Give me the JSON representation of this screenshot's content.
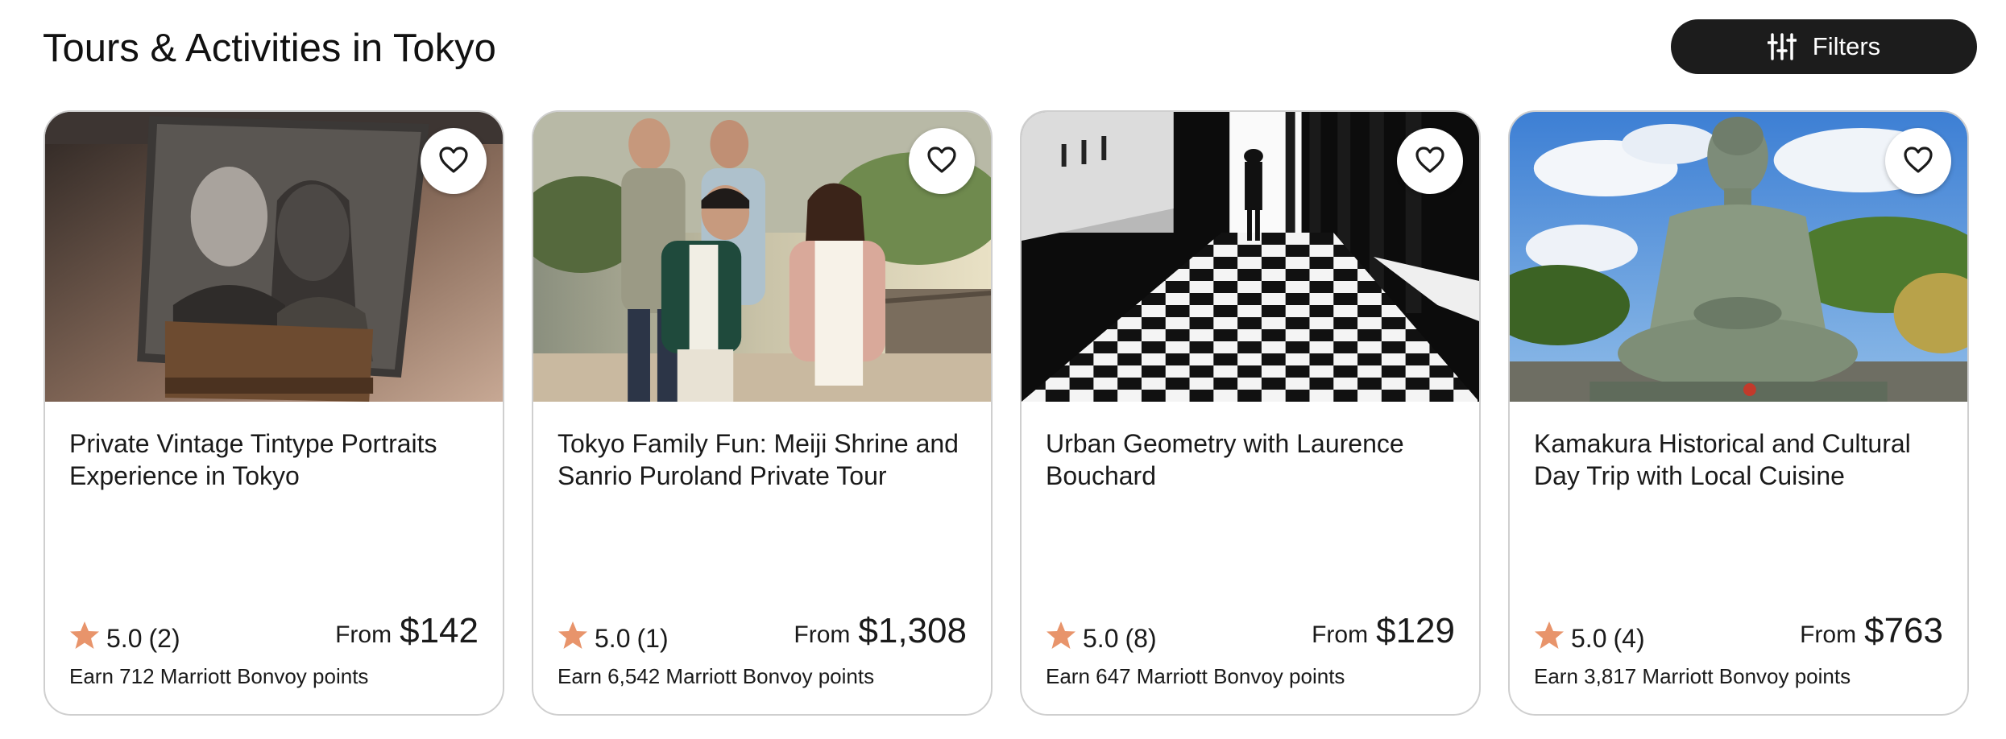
{
  "page": {
    "title": "Tours & Activities in Tokyo"
  },
  "toolbar": {
    "filters_label": "Filters",
    "filters_icon": "sliders-icon"
  },
  "colors": {
    "star": "#e8946b",
    "button_bg": "#1c1c1c",
    "card_border": "#cfcfcf"
  },
  "cards": [
    {
      "title": "Private Vintage Tintype Portraits Experience in Tokyo",
      "rating": "5.0",
      "reviews": "(2)",
      "from_label": "From",
      "price": "$142",
      "points": "Earn 712 Marriott Bonvoy points",
      "favorite_icon": "heart-outline-icon"
    },
    {
      "title": "Tokyo Family Fun: Meiji Shrine and Sanrio Puroland Private Tour",
      "rating": "5.0",
      "reviews": "(1)",
      "from_label": "From",
      "price": "$1,308",
      "points": "Earn 6,542 Marriott Bonvoy points",
      "favorite_icon": "heart-outline-icon"
    },
    {
      "title": "Urban Geometry with Laurence Bouchard",
      "rating": "5.0",
      "reviews": "(8)",
      "from_label": "From",
      "price": "$129",
      "points": "Earn 647 Marriott Bonvoy points",
      "favorite_icon": "heart-outline-icon"
    },
    {
      "title": "Kamakura Historical and Cultural Day Trip with Local Cuisine",
      "rating": "5.0",
      "reviews": "(4)",
      "from_label": "From",
      "price": "$763",
      "points": "Earn 3,817 Marriott Bonvoy points",
      "favorite_icon": "heart-outline-icon"
    }
  ]
}
